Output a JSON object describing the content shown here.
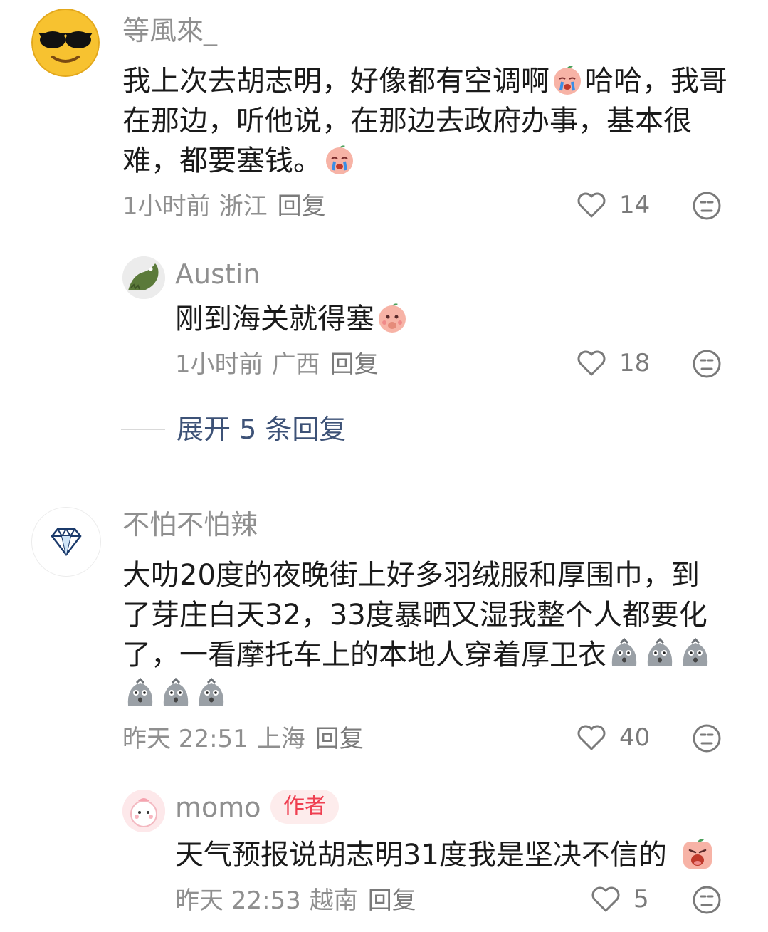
{
  "comments": [
    {
      "username": "等風來_",
      "text_parts": [
        "我上次去胡志明，好像都有空调啊",
        "哈哈，我哥在那边，听他说，在那边去政府办事，基本很难，都要塞钱。"
      ],
      "time": "1小时前",
      "location": "浙江",
      "reply_label": "回复",
      "likes": "14"
    },
    {
      "username": "Austin",
      "text": "刚到海关就得塞",
      "time": "1小时前",
      "location": "广西",
      "reply_label": "回复",
      "likes": "18"
    },
    {
      "username": "不怕不怕辣",
      "text_lines": [
        "大叻20度的夜晚街上好多羽绒服和厚围巾，到",
        "了芽庄白天32，33度暴晒又湿我整个人都要化",
        "了，一看摩托车上的本地人穿着厚卫衣"
      ],
      "time": "昨天 22:51",
      "location": "上海",
      "reply_label": "回复",
      "likes": "40"
    },
    {
      "username": "momo",
      "badge": "作者",
      "text": "天气预报说胡志明31度我是坚决不信的",
      "time": "昨天 22:53",
      "location": "越南",
      "reply_label": "回复",
      "likes": "5"
    }
  ],
  "expand_replies": "展开 5 条回复",
  "icons": [
    "heart-outline-icon",
    "dislike-face-icon",
    "crying-emoji-icon",
    "shocked-emoji-icon"
  ],
  "colors": {
    "link": "#3d5277",
    "badge_text": "#ef3f51",
    "badge_bg": "#fdecec",
    "meta": "#8f8f8f"
  }
}
